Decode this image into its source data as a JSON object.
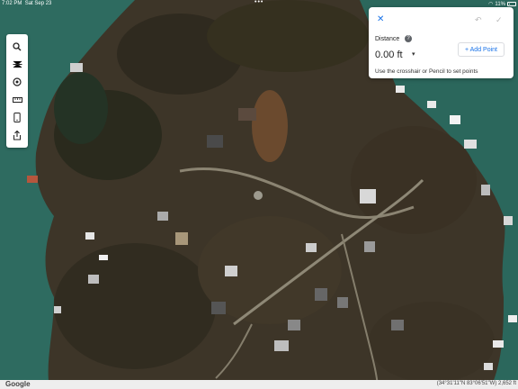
{
  "status_bar": {
    "time": "7:02 PM",
    "date": "Sat Sep 23",
    "dots": "•••",
    "battery": "11%"
  },
  "toolbar": {
    "tools": [
      {
        "name": "search-icon",
        "glyph": "⌕"
      },
      {
        "name": "spider-icon",
        "glyph": "✱"
      },
      {
        "name": "sightseeing-icon",
        "glyph": "⊛"
      },
      {
        "name": "ruler-icon",
        "glyph": "▭"
      },
      {
        "name": "phone-icon",
        "glyph": "▯"
      },
      {
        "name": "share-icon",
        "glyph": "⇪"
      }
    ]
  },
  "distance_panel": {
    "close_glyph": "✕",
    "undo_glyph": "↶",
    "done_glyph": "✓",
    "label": "Distance",
    "help_glyph": "?",
    "value": "0.00 ft",
    "unit_caret": "▾",
    "add_point_label": "+ Add Point",
    "hint": "Use the crosshair or Pencil to set points"
  },
  "footer": {
    "logo": "Google",
    "coordinates": "(34°31'11\"N 83°06'51\"W) 2,652 ft"
  },
  "colors": {
    "accent": "#1a73e8",
    "water": "#2d6b5f",
    "land": "#3b3326"
  }
}
